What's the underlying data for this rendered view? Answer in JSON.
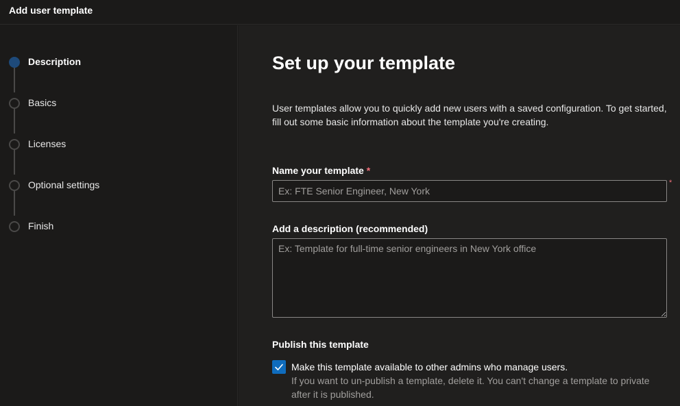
{
  "window": {
    "title": "Add user template"
  },
  "steps": [
    {
      "label": "Description",
      "active": true
    },
    {
      "label": "Basics",
      "active": false
    },
    {
      "label": "Licenses",
      "active": false
    },
    {
      "label": "Optional settings",
      "active": false
    },
    {
      "label": "Finish",
      "active": false
    }
  ],
  "main": {
    "heading": "Set up your template",
    "intro": "User templates allow you to quickly add new users with a saved configuration. To get started, fill out some basic information about the template you're creating.",
    "name_field": {
      "label": "Name your template",
      "required_mark": "*",
      "value": "",
      "placeholder": "Ex: FTE Senior Engineer, New York"
    },
    "description_field": {
      "label": "Add a description (recommended)",
      "value": "",
      "placeholder": "Ex: Template for full-time senior engineers in New York office"
    },
    "publish": {
      "heading": "Publish this template",
      "checkbox_label": "Make this template available to other admins who manage users.",
      "checked": true,
      "help_text": "If you want to un-publish a template, delete it. You can't change a template to private after it is published."
    }
  },
  "colors": {
    "accent": "#0f6cbd",
    "active_step": "#1e4a7a",
    "required": "#f1707b"
  },
  "icons": [
    "checkmark-icon"
  ]
}
